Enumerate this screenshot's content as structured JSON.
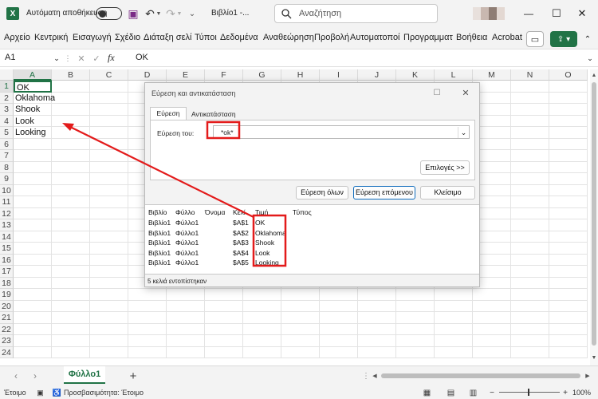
{
  "titlebar": {
    "autosave_label": "Αυτόματη αποθήκευση",
    "filename": "Βιβλίο1 -...",
    "search_placeholder": "Αναζήτηση",
    "accent": "#217346"
  },
  "menu": [
    "Αρχείο",
    "Κεντρική",
    "Εισαγωγή",
    "Σχέδιο",
    "Διάταξη σελί",
    "Τύποι",
    "Δεδομένα",
    "Αναθεώρηση",
    "Προβολή",
    "Αυτοματοποί",
    "Προγραμματ",
    "Βοήθεια",
    "Acrobat"
  ],
  "formula": {
    "name_box": "A1",
    "fx": "fx",
    "value": "OK"
  },
  "columns": [
    "A",
    "B",
    "C",
    "D",
    "E",
    "F",
    "G",
    "H",
    "I",
    "J",
    "K",
    "L",
    "M",
    "N",
    "O"
  ],
  "rows": [
    "1",
    "2",
    "3",
    "4",
    "5",
    "6",
    "7",
    "8",
    "9",
    "10",
    "11",
    "12",
    "13",
    "14",
    "15",
    "16",
    "17",
    "18",
    "19",
    "20",
    "21",
    "22",
    "23",
    "24"
  ],
  "cells_a": [
    "OK",
    "Oklahoma",
    "Shook",
    "Look",
    "Looking"
  ],
  "dialog": {
    "title": "Εύρεση και αντικατάσταση",
    "tab_find": "Εύρεση",
    "tab_replace": "Αντικατάσταση",
    "find_label": "Εύρεση του:",
    "find_value": "*ok*",
    "options_button": "Επιλογές >>",
    "find_all_button": "Εύρεση όλων",
    "find_next_button": "Εύρεση επόμενου",
    "close_button": "Κλείσιμο",
    "results_headers": [
      "Βιβλίο",
      "Φύλλο",
      "Όνομα",
      "Κελί",
      "Τιμή",
      "Τύπος"
    ],
    "results": [
      [
        "Βιβλίο1",
        "Φύλλο1",
        "",
        "$A$1",
        "OK",
        ""
      ],
      [
        "Βιβλίο1",
        "Φύλλο1",
        "",
        "$A$2",
        "Oklahoma",
        ""
      ],
      [
        "Βιβλίο1",
        "Φύλλο1",
        "",
        "$A$3",
        "Shook",
        ""
      ],
      [
        "Βιβλίο1",
        "Φύλλο1",
        "",
        "$A$4",
        "Look",
        ""
      ],
      [
        "Βιβλίο1",
        "Φύλλο1",
        "",
        "$A$5",
        "Looking",
        ""
      ]
    ],
    "status": "5 κελιά εντοπίστηκαν"
  },
  "sheet_tab": "Φύλλο1",
  "status": {
    "ready": "Έτοιμο",
    "accessibility": "Προσβασιμότητα: Έτοιμο",
    "zoom": "100%"
  },
  "annotation_color": "#e31b1b"
}
